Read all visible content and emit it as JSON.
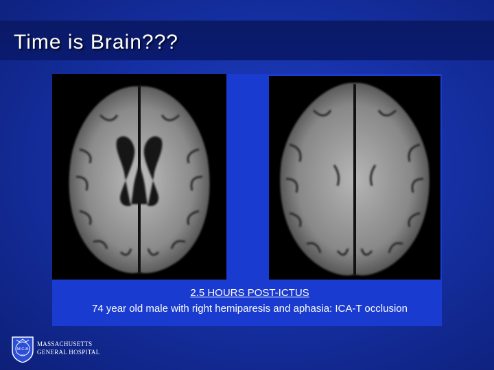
{
  "slide": {
    "title": "Time is Brain???",
    "caption_heading": "2.5 HOURS POST-ICTUS",
    "caption_text": "74 year old male with right hemiparesis and aphasia: ICA-T occlusion"
  },
  "images": [
    {
      "name": "mri-scan-left",
      "description_icon": "brain-mri-axial-ventricles"
    },
    {
      "name": "mri-scan-right",
      "description_icon": "brain-mri-axial-upper"
    }
  ],
  "logo": {
    "seal_text": "M.G.H",
    "seal_year": "1811",
    "line1": "MASSACHUSETTS",
    "line2": "GENERAL HOSPITAL"
  },
  "colors": {
    "background": "#1631a6",
    "title_band": "#0a1a70",
    "text": "#ffffff"
  }
}
